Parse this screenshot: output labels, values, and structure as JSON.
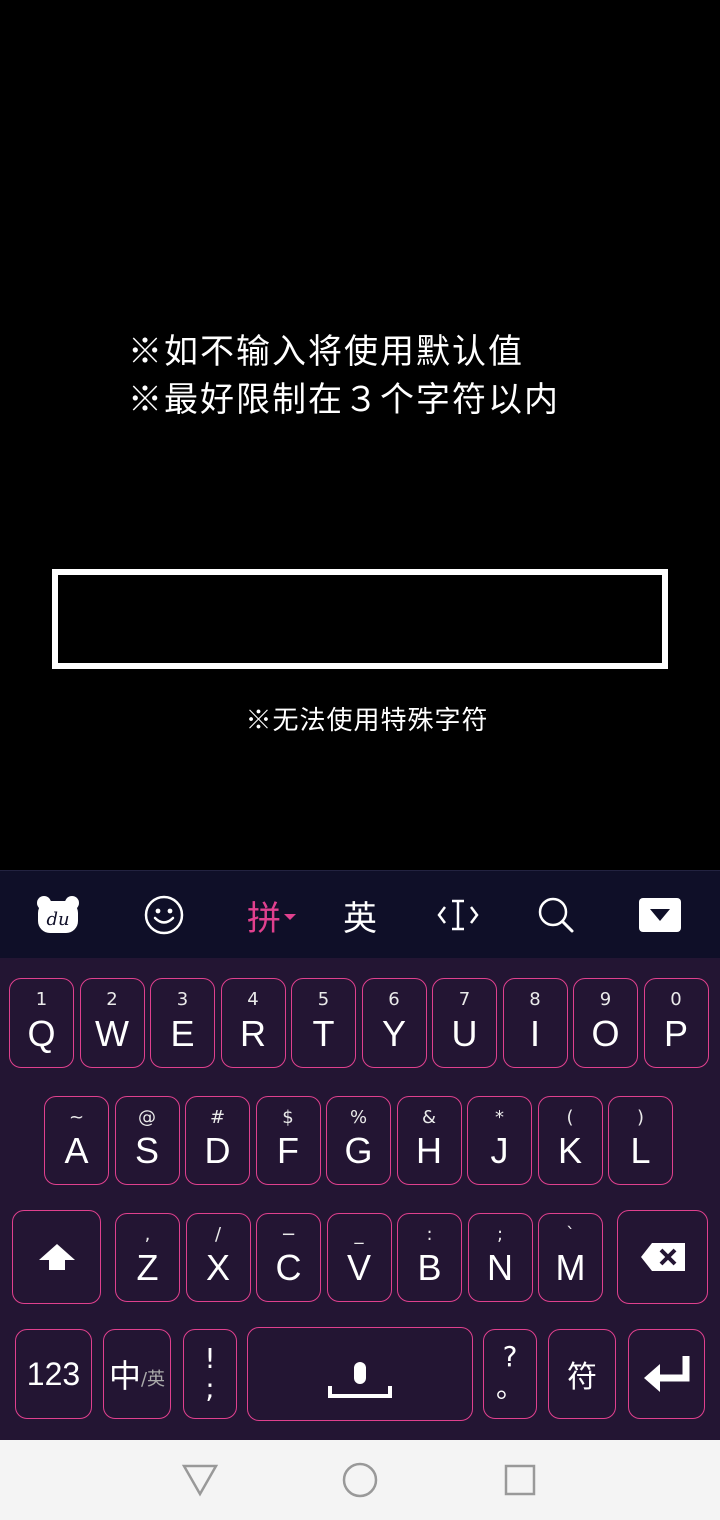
{
  "game": {
    "hint_line1": "※如不输入将使用默认值",
    "hint_line2": "※最好限制在３个字符以内",
    "name_value": "",
    "sub_hint": "※无法使用特殊字符"
  },
  "toolbar": {
    "pinyin_label": "拼",
    "english_label": "英"
  },
  "keyboard": {
    "row1": [
      {
        "sub": "1",
        "main": "Q"
      },
      {
        "sub": "2",
        "main": "W"
      },
      {
        "sub": "3",
        "main": "E"
      },
      {
        "sub": "4",
        "main": "R"
      },
      {
        "sub": "5",
        "main": "T"
      },
      {
        "sub": "6",
        "main": "Y"
      },
      {
        "sub": "7",
        "main": "U"
      },
      {
        "sub": "8",
        "main": "I"
      },
      {
        "sub": "9",
        "main": "O"
      },
      {
        "sub": "0",
        "main": "P"
      }
    ],
    "row2": [
      {
        "sub": "~",
        "main": "A"
      },
      {
        "sub": "@",
        "main": "S"
      },
      {
        "sub": "#",
        "main": "D"
      },
      {
        "sub": "$",
        "main": "F"
      },
      {
        "sub": "%",
        "main": "G"
      },
      {
        "sub": "&",
        "main": "H"
      },
      {
        "sub": "*",
        "main": "J"
      },
      {
        "sub": "(",
        "main": "K"
      },
      {
        "sub": ")",
        "main": "L"
      }
    ],
    "row3": [
      {
        "sub": ",",
        "main": "Z"
      },
      {
        "sub": "/",
        "main": "X"
      },
      {
        "sub": "−",
        "main": "C"
      },
      {
        "sub": "_",
        "main": "V"
      },
      {
        "sub": ":",
        "main": "B"
      },
      {
        "sub": ";",
        "main": "N"
      },
      {
        "sub": "`",
        "main": "M"
      }
    ],
    "num_label": "123",
    "lang_main": "中",
    "lang_sub": "/英",
    "punct1_top": "!",
    "punct1_bottom": ";",
    "punct2_top": "?",
    "punct2_bottom": "。",
    "symbol_label": "符"
  },
  "colors": {
    "accent": "#e0408e",
    "keyboard_bg": "#231533",
    "toolbar_bg": "#0f0f28"
  }
}
